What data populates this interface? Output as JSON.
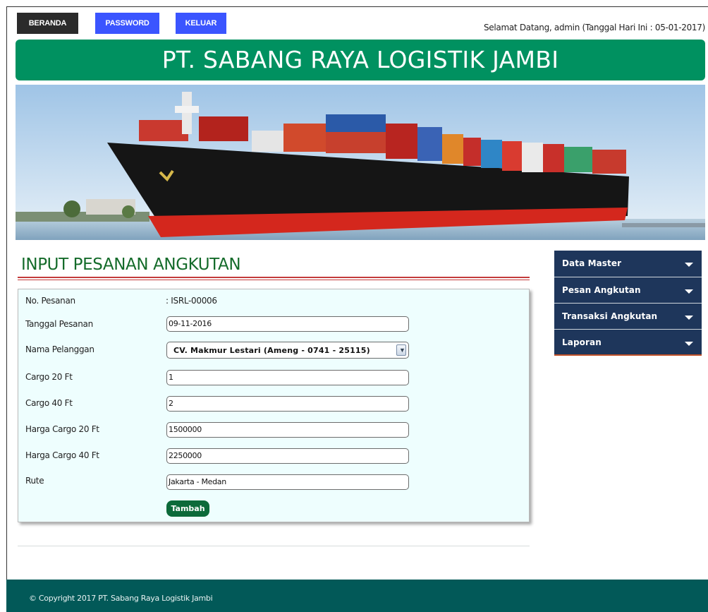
{
  "nav": {
    "beranda": "BERANDA",
    "password": "PASSWORD",
    "keluar": "KELUAR"
  },
  "welcome": "Selamat Datang, admin (Tanggal Hari Ini : 05-01-2017)",
  "header": {
    "title": "PT. SABANG RAYA LOGISTIK JAMBI"
  },
  "page_title": "INPUT PESANAN ANGKUTAN",
  "form": {
    "no_pesanan": {
      "label": "No. Pesanan",
      "value": ": ISRL-00006"
    },
    "tanggal_pesanan": {
      "label": "Tanggal Pesanan",
      "value": "09-11-2016"
    },
    "nama_pelanggan": {
      "label": "Nama Pelanggan",
      "value": "CV. Makmur Lestari (Ameng - 0741 - 25115)"
    },
    "cargo20": {
      "label": "Cargo 20 Ft",
      "value": "1"
    },
    "cargo40": {
      "label": "Cargo 40 Ft",
      "value": "2"
    },
    "harga20": {
      "label": "Harga Cargo 20 Ft",
      "value": "1500000"
    },
    "harga40": {
      "label": "Harga Cargo 40 Ft",
      "value": "2250000"
    },
    "rute": {
      "label": "Rute",
      "value": "Jakarta - Medan"
    },
    "submit_label": "Tambah"
  },
  "sidebar": {
    "items": [
      {
        "label": "Data Master",
        "icon": "caret-down-icon"
      },
      {
        "label": "Pesan Angkutan",
        "icon": "caret-down-icon"
      },
      {
        "label": "Transaksi Angkutan",
        "icon": "caret-down-icon"
      },
      {
        "label": "Laporan",
        "icon": "caret-down-icon"
      }
    ]
  },
  "footer": {
    "text": "© Copyright 2017 PT. Sabang Raya Logistik Jambi"
  },
  "colors": {
    "nav_home": "#2b2b2b",
    "nav_accent": "#3b55ff",
    "header_green": "#009160",
    "title_green": "#146b2a",
    "title_line": "#c33b3b",
    "panel_bg": "#eefefe",
    "button_green": "#0c6a3a",
    "menu_navy": "#1e365b",
    "footer_teal": "#025958"
  }
}
